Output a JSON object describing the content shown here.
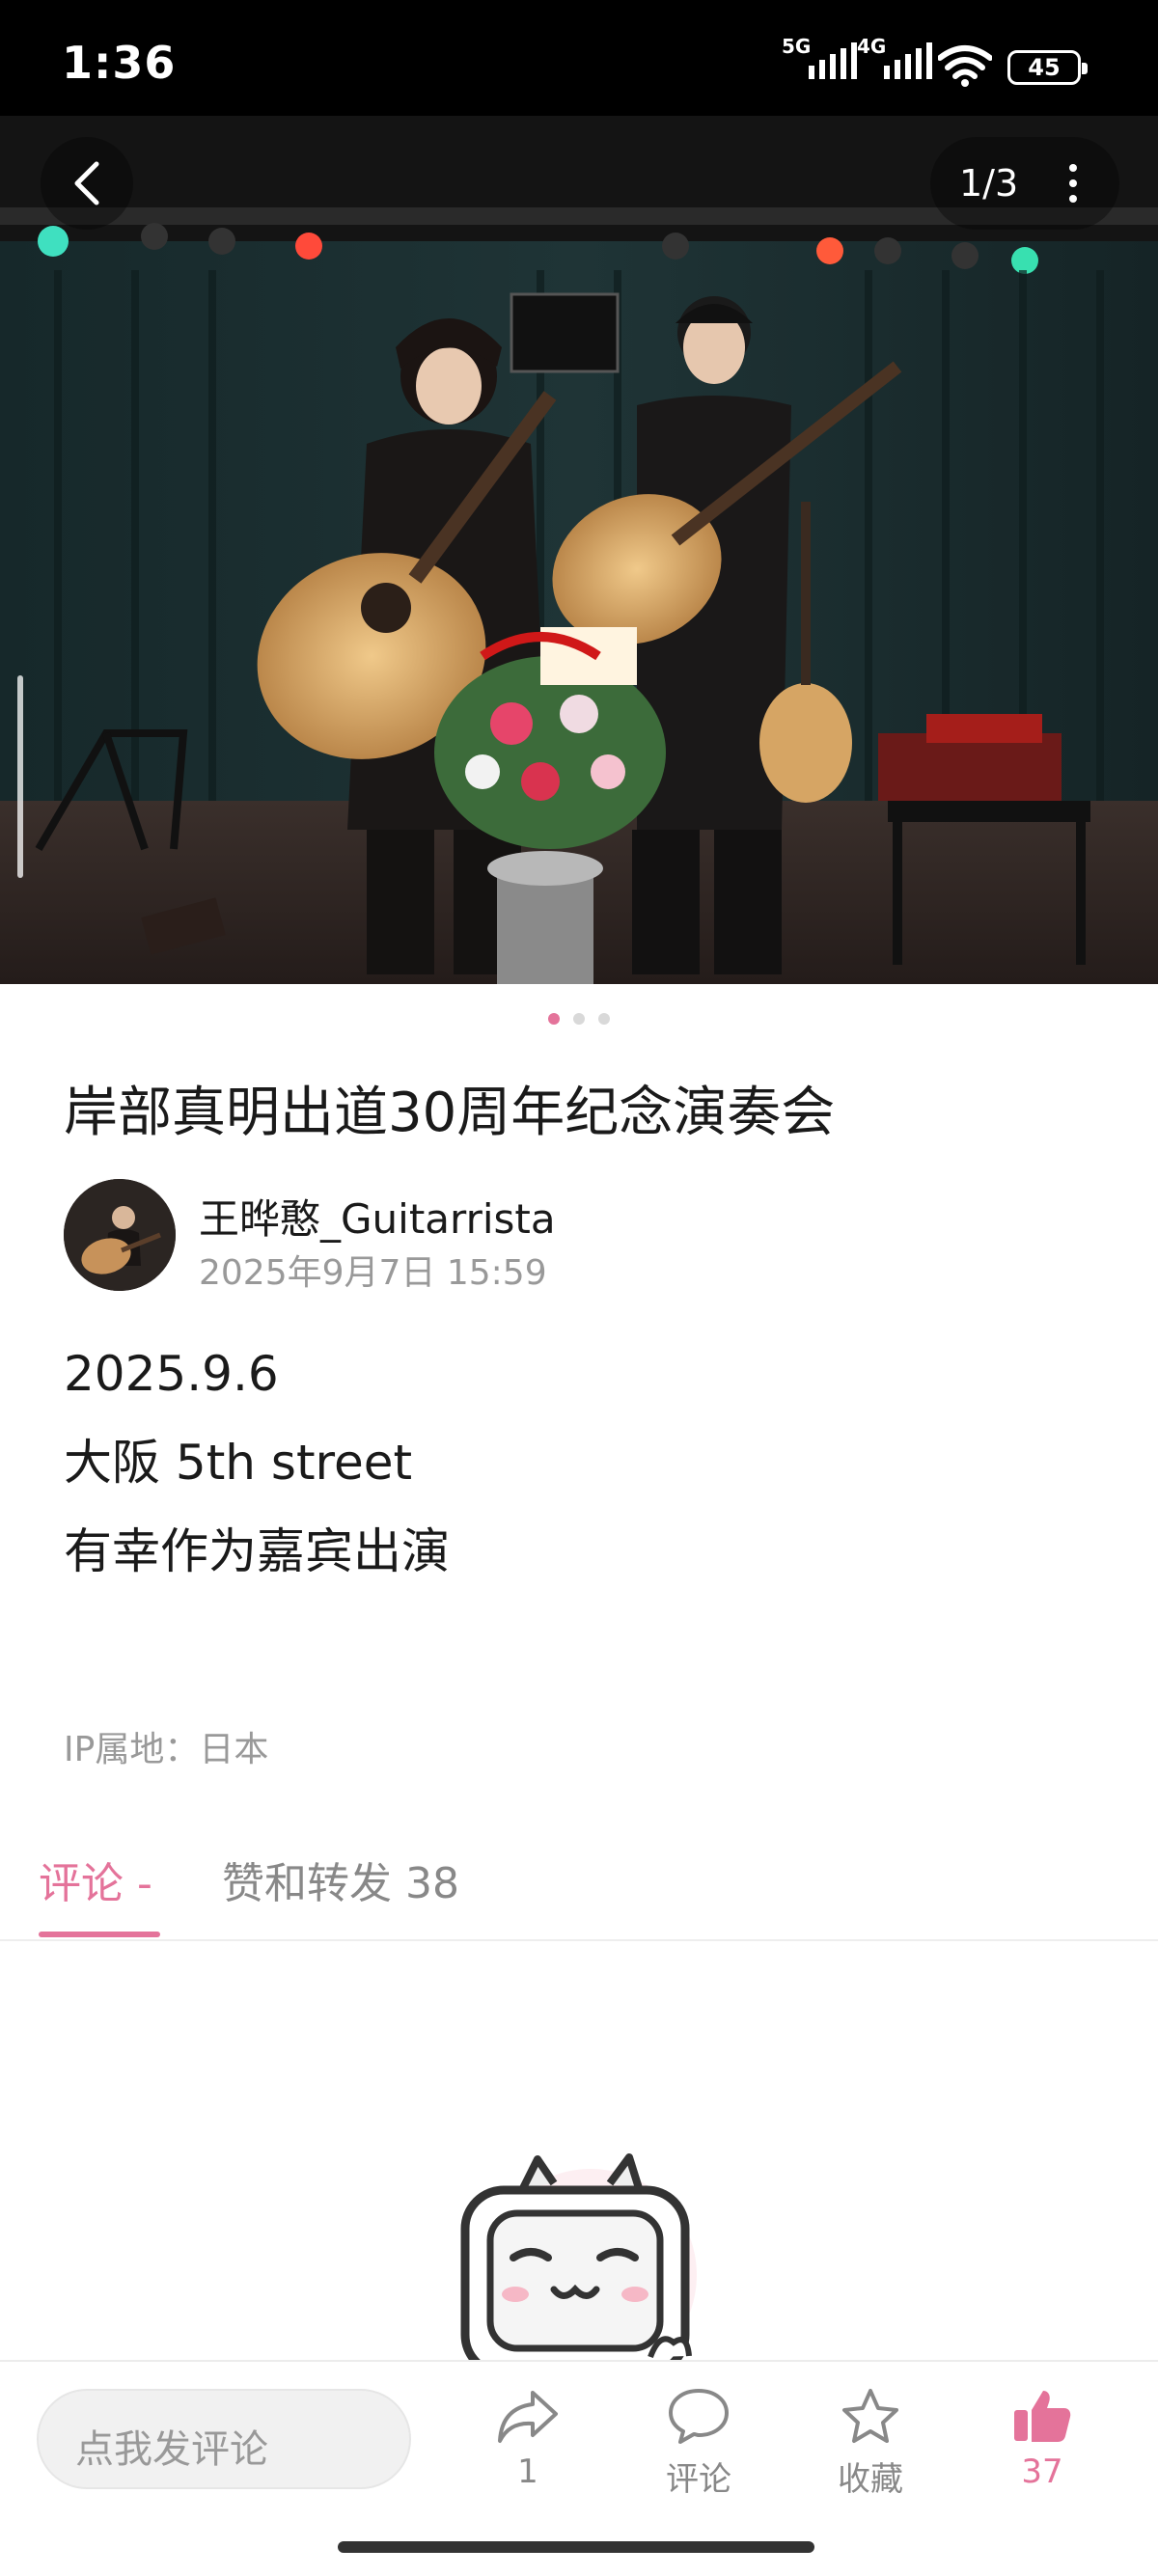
{
  "status_bar": {
    "time": "1:36",
    "signal1_label": "5G",
    "signal2_label": "4G",
    "battery": "45"
  },
  "viewer": {
    "counter": "1/3",
    "back_icon": "chevron-left-icon",
    "more_icon": "more-vertical-icon",
    "page_dots": 3,
    "active_dot": 0,
    "photo_description_icon": "photo"
  },
  "post": {
    "title": "岸部真明出道30周年纪念演奏会",
    "author_name": "王晔憨_Guitarrista",
    "post_time": "2025年9月7日 15:59",
    "body_lines": [
      "2025.9.6",
      "大阪 5th street",
      "有幸作为嘉宾出演"
    ],
    "ip_location": "IP属地：日本"
  },
  "tabs": {
    "comments_label": "评论 -",
    "likes_label": "赞和转发 38"
  },
  "bottom_bar": {
    "comment_placeholder": "点我发评论",
    "share_count": "1",
    "comment_label": "评论",
    "favorite_label": "收藏",
    "like_count": "37"
  },
  "colors": {
    "accent": "#e4739a",
    "muted_text": "#999999",
    "status_bar_bg": "#000000"
  }
}
